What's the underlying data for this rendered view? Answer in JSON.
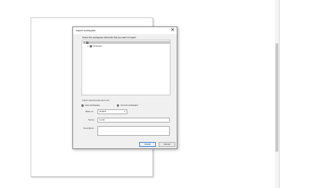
{
  "dialog": {
    "title": "Import workspace",
    "close_glyph": "✕",
    "instruction": "Select the workspace elements that you want to import:",
    "tree": [
      {
        "label": "",
        "checked": true,
        "expander": "▾",
        "selected": true
      },
      {
        "label": "Timeliners",
        "checked": true,
        "expander": "▸",
        "selected": false
      }
    ],
    "section_label": "Import selected elements into",
    "options": {
      "new_workspace": "New workspace",
      "current_workspace": "Current workspace"
    },
    "based_on_label": "Base on:",
    "based_on_value": "Default",
    "name_label": "Name:",
    "name_value": "Local",
    "description_label": "Description:",
    "description_value": "",
    "buttons": {
      "import": "Import",
      "cancel": "Cancel"
    }
  },
  "colors": {
    "accent": "#3b7bd6",
    "dialog_bg": "#f0f0f0",
    "selected_row": "#c9c9c9"
  },
  "icons": {
    "close": "close-icon",
    "expand": "chevron-down-icon",
    "collapse": "chevron-right-icon",
    "dropdown": "chevron-down-icon"
  }
}
